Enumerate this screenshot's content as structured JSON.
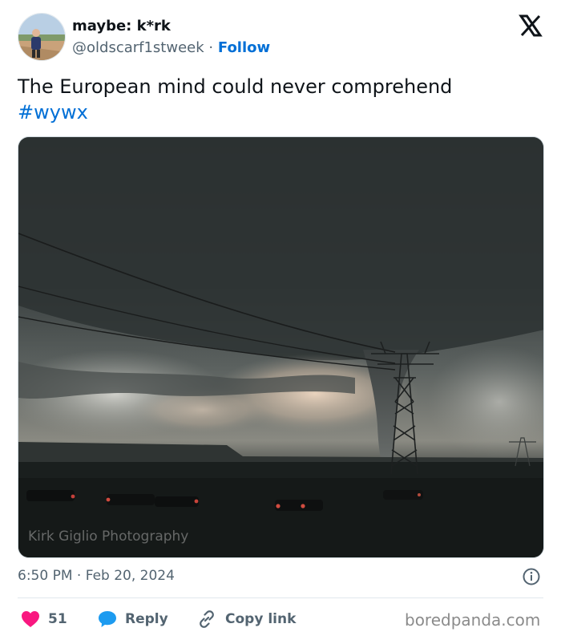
{
  "author": {
    "display_name": "maybe: k*rk",
    "handle": "@oldscarf1stweek",
    "separator": "·",
    "follow_label": "Follow",
    "avatar_icon": "avatar-photo-person-field"
  },
  "platform": {
    "logo_icon": "x-logo-icon"
  },
  "tweet": {
    "text": "The European mind could never comprehend",
    "hashtag": "#wywx"
  },
  "media": {
    "watermark": "Kirk Giglio Photography"
  },
  "meta": {
    "time": "6:50 PM",
    "separator": "·",
    "date": "Feb 20, 2024",
    "info_icon": "info-icon"
  },
  "actions": {
    "likes_count": "51",
    "reply_label": "Reply",
    "copy_link_label": "Copy link"
  },
  "source": {
    "label": "boredpanda.com"
  },
  "colors": {
    "link_blue": "#006fd6",
    "heart_red": "#f91880",
    "reply_blue": "#1d9bf0",
    "text_dark": "#0f1419",
    "text_muted": "#536471"
  }
}
